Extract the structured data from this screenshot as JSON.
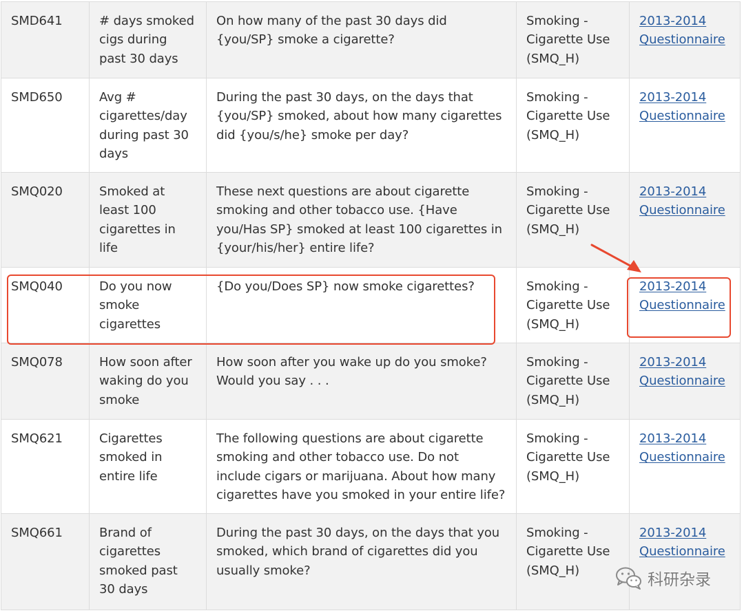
{
  "rows": [
    {
      "code": "SMD641",
      "label": "# days smoked cigs during past 30 days",
      "text": "On how many of the past 30 days did {you/SP} smoke a cigarette?",
      "component": "Smoking - Cigarette Use (SMQ_H)",
      "link_year": "2013-2014",
      "link_doc": "Questionnaire"
    },
    {
      "code": "SMD650",
      "label": "Avg # cigarettes/day during past 30 days",
      "text": "During the past 30 days, on the days that {you/SP} smoked, about how many cigarettes did {you/s/he} smoke per day?",
      "component": "Smoking - Cigarette Use (SMQ_H)",
      "link_year": "2013-2014",
      "link_doc": "Questionnaire"
    },
    {
      "code": "SMQ020",
      "label": "Smoked at least 100 cigarettes in life",
      "text": "These next questions are about cigarette smoking and other tobacco use. {Have you/Has SP} smoked at least 100 cigarettes in {your/his/her} entire life?",
      "component": "Smoking - Cigarette Use (SMQ_H)",
      "link_year": "2013-2014",
      "link_doc": "Questionnaire"
    },
    {
      "code": "SMQ040",
      "label": "Do you now smoke cigarettes",
      "text": "{Do you/Does SP} now smoke cigarettes?",
      "component": "Smoking - Cigarette Use (SMQ_H)",
      "link_year": "2013-2014",
      "link_doc": "Questionnaire"
    },
    {
      "code": "SMQ078",
      "label": "How soon after waking do you smoke",
      "text": "How soon after you wake up do you smoke? Would you say . . .",
      "component": "Smoking - Cigarette Use (SMQ_H)",
      "link_year": "2013-2014",
      "link_doc": "Questionnaire"
    },
    {
      "code": "SMQ621",
      "label": "Cigarettes smoked in entire life",
      "text": "The following questions are about cigarette smoking and other tobacco use. Do not include cigars or marijuana. About how many cigarettes have you smoked in your entire life?",
      "component": "Smoking - Cigarette Use (SMQ_H)",
      "link_year": "2013-2014",
      "link_doc": "Questionnaire"
    },
    {
      "code": "SMQ661",
      "label": "Brand of cigarettes smoked past 30 days",
      "text": "During the past 30 days, on the days that you smoked, which brand of cigarettes did you usually smoke?",
      "component": "Smoking - Cigarette Use (SMQ_H)",
      "link_year": "2013-2014",
      "link_doc": "Questionnaire"
    }
  ],
  "watermark": {
    "text": "科研杂录",
    "icon": "wechat-icon"
  },
  "colors": {
    "annotation": "#e8482f",
    "link": "#2a5c9e",
    "row_shaded": "#f2f2f2",
    "border": "#dcdcdc"
  }
}
